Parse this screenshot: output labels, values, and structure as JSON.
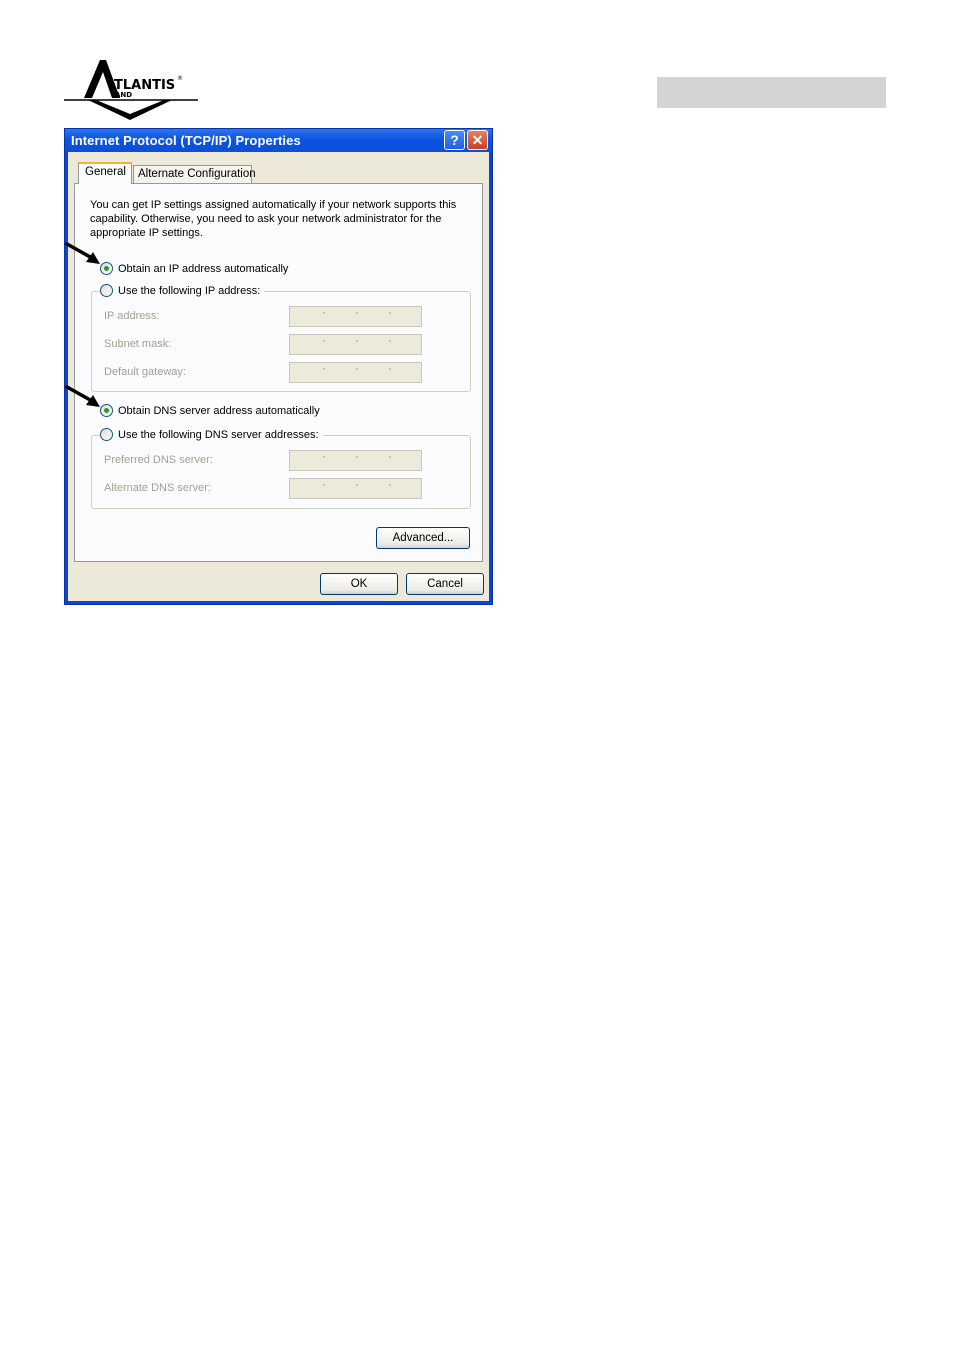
{
  "brand": {
    "logo_text": "ATLANTIS AND"
  },
  "dialog": {
    "title": "Internet Protocol (TCP/IP) Properties",
    "help_glyph": "?",
    "close_glyph": "✕",
    "tabs": [
      {
        "label": "General",
        "active": true
      },
      {
        "label": "Alternate Configuration",
        "active": false
      }
    ],
    "intro_text": "You can get IP settings assigned automatically if your network supports this capability. Otherwise, you need to ask your network administrator for the appropriate IP settings.",
    "ip_section": {
      "auto_label": "Obtain an IP address automatically",
      "manual_label": "Use the following IP address:",
      "selected": "auto",
      "fields": [
        {
          "label": "IP address:",
          "value": ""
        },
        {
          "label": "Subnet mask:",
          "value": ""
        },
        {
          "label": "Default gateway:",
          "value": ""
        }
      ]
    },
    "dns_section": {
      "auto_label": "Obtain DNS server address automatically",
      "manual_label": "Use the following DNS server addresses:",
      "selected": "auto",
      "fields": [
        {
          "label": "Preferred DNS server:",
          "value": ""
        },
        {
          "label": "Alternate DNS server:",
          "value": ""
        }
      ]
    },
    "advanced_label": "Advanced...",
    "ok_label": "OK",
    "cancel_label": "Cancel"
  },
  "colors": {
    "title_bar": "#0a4fd8",
    "dialog_face": "#ece9d8",
    "radio_checked": "#21a121",
    "header_bar": "#d4d4d4"
  }
}
